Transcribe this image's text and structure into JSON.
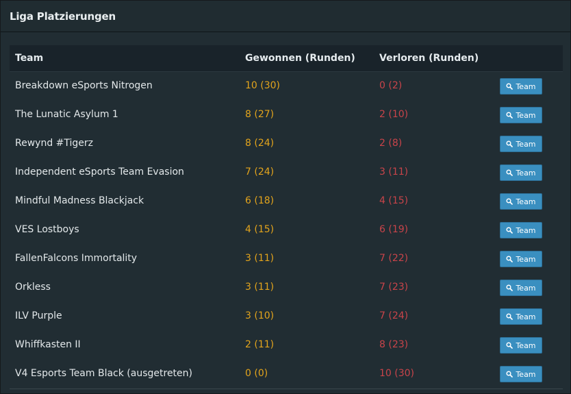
{
  "panel": {
    "title": "Liga Platzierungen"
  },
  "table": {
    "headers": {
      "team": "Team",
      "won": "Gewonnen (Runden)",
      "lost": "Verloren (Runden)"
    },
    "button_label": "Team",
    "button_icon": "search-icon",
    "rows": [
      {
        "team": "Breakdown eSports Nitrogen",
        "won": "10 (30)",
        "lost": "0 (2)"
      },
      {
        "team": "The Lunatic Asylum 1",
        "won": "8 (27)",
        "lost": "2 (10)"
      },
      {
        "team": "Rewynd #Tigerz",
        "won": "8 (24)",
        "lost": "2 (8)"
      },
      {
        "team": "Independent eSports Team Evasion",
        "won": "7 (24)",
        "lost": "3 (11)"
      },
      {
        "team": "Mindful Madness Blackjack",
        "won": "6 (18)",
        "lost": "4 (15)"
      },
      {
        "team": "VES Lostboys",
        "won": "4 (15)",
        "lost": "6 (19)"
      },
      {
        "team": "FallenFalcons Immortality",
        "won": "3 (11)",
        "lost": "7 (22)"
      },
      {
        "team": "Orkless",
        "won": "3 (11)",
        "lost": "7 (23)"
      },
      {
        "team": "ILV Purple",
        "won": "3 (10)",
        "lost": "7 (24)"
      },
      {
        "team": "Whiffkasten II",
        "won": "2 (11)",
        "lost": "8 (23)"
      },
      {
        "team": "V4 Esports Team Black (ausgetreten)",
        "won": "0 (0)",
        "lost": "10 (30)"
      }
    ]
  },
  "colors": {
    "won": "#e3a41c",
    "lost": "#c9444a",
    "button": "#3a8fc0"
  }
}
